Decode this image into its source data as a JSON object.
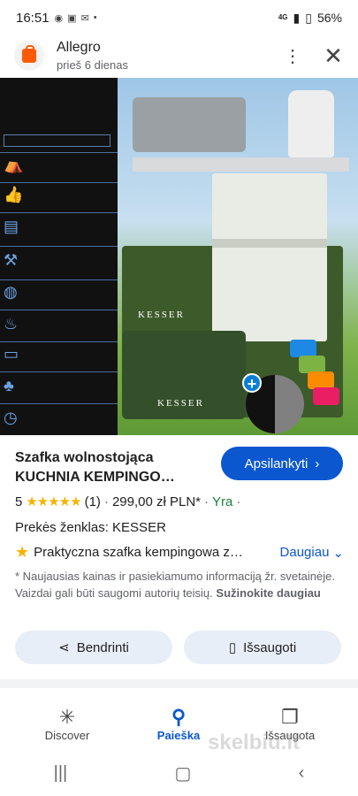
{
  "status_bar": {
    "time": "16:51",
    "battery": "56%",
    "network": "4G"
  },
  "header": {
    "app_name": "Allegro",
    "subtitle": "prieš 6 dienas"
  },
  "product": {
    "title": "Szafka wolnostojąca KUCHNIA KEMPINGO…",
    "visit_label": "Apsilankyti",
    "rating_value": "5",
    "stars": "★★★★★",
    "reviews": "(1)",
    "price": "299,00 zł PLN*",
    "condition": "Yra",
    "brand_line": "Prekės ženklas: KESSER",
    "feature": "Praktyczna szafka kempingowa z…",
    "more_label": "Daugiau",
    "disclaimer": "* Naujausias kainas ir pasiekiamumo informaciją žr. svetainėje. Vaizdai gali būti saugomi autorių teisių.",
    "learn_more": "Sužinokite daugiau",
    "share_label": "Bendrinti",
    "save_label": "Išsaugoti",
    "image_brand": "KESSER"
  },
  "bottom_nav": [
    {
      "label": "Discover",
      "icon": "asterisk-icon"
    },
    {
      "label": "Paieška",
      "icon": "search-icon"
    },
    {
      "label": "Išsaugota",
      "icon": "bookmarks-icon"
    }
  ],
  "watermark": "skelbiu.lt",
  "colors": {
    "accent": "#0b57d0",
    "star": "#f4b400",
    "condition": "#188038",
    "brand_orange": "#ff5a00"
  }
}
